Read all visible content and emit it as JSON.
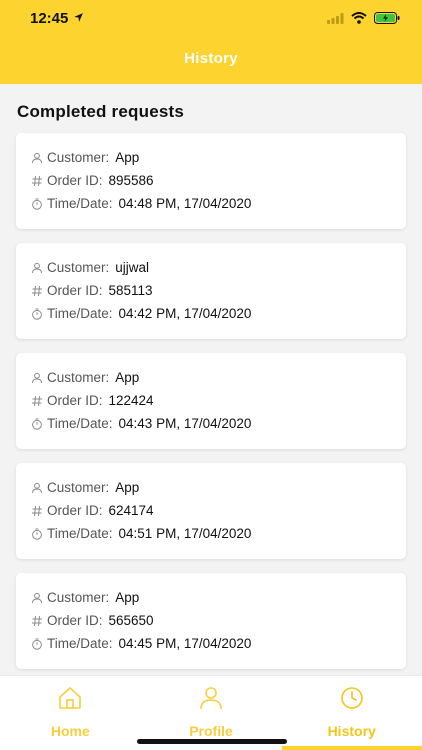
{
  "status_bar": {
    "time": "12:45"
  },
  "header": {
    "title": "History"
  },
  "section": {
    "title": "Completed requests"
  },
  "labels": {
    "customer": "Customer:",
    "order_id": "Order ID:",
    "time_date": "Time/Date:"
  },
  "requests": [
    {
      "customer": "App",
      "order_id": "895586",
      "time_date": "04:48 PM, 17/04/2020"
    },
    {
      "customer": "ujjwal",
      "order_id": "585113",
      "time_date": "04:42 PM, 17/04/2020"
    },
    {
      "customer": "App",
      "order_id": "122424",
      "time_date": "04:43 PM, 17/04/2020"
    },
    {
      "customer": "App",
      "order_id": "624174",
      "time_date": "04:51 PM, 17/04/2020"
    },
    {
      "customer": "App",
      "order_id": "565650",
      "time_date": "04:45 PM, 17/04/2020"
    }
  ],
  "nav": {
    "items": [
      {
        "label": "Home",
        "icon": "home-icon"
      },
      {
        "label": "Profile",
        "icon": "user-icon"
      },
      {
        "label": "History",
        "icon": "clock-icon"
      }
    ],
    "active": "History"
  },
  "colors": {
    "accent": "#fdd32f",
    "nav_label": "#f5c419",
    "background": "#f3f3f3"
  }
}
